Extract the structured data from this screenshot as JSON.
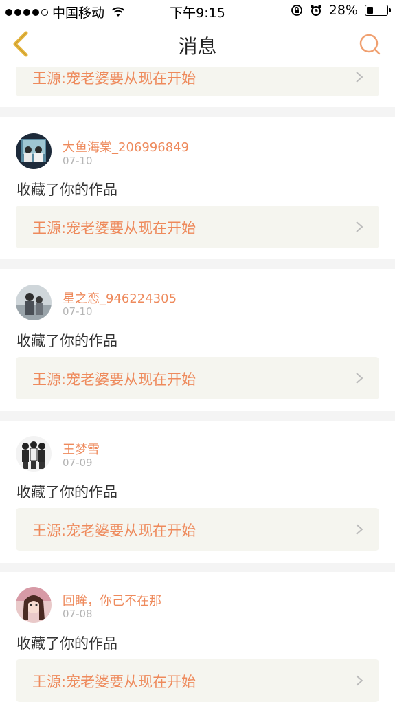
{
  "status_bar": {
    "carrier": "中国移动",
    "time": "下午9:15",
    "battery": "28%",
    "battery_level": 0.28
  },
  "nav": {
    "title": "消息",
    "back_icon": "chevron-left-icon",
    "search_icon": "search-icon"
  },
  "top_card": {
    "work_title": "王源:宠老婆要从现在开始"
  },
  "notifications": [
    {
      "user": "大鱼海棠_206996849",
      "date": "07-10",
      "action": "收藏了你的作品",
      "work_title": "王源:宠老婆要从现在开始"
    },
    {
      "user": "星之恋_946224305",
      "date": "07-10",
      "action": "收藏了你的作品",
      "work_title": "王源:宠老婆要从现在开始"
    },
    {
      "user": "王梦雪",
      "date": "07-09",
      "action": "收藏了你的作品",
      "work_title": "王源:宠老婆要从现在开始"
    },
    {
      "user": "回眸，你己不在那",
      "date": "07-08",
      "action": "收藏了你的作品",
      "work_title": "王源:宠老婆要从现在开始"
    }
  ],
  "colors": {
    "accent": "#ee8a5c",
    "back_icon": "#e6b53c",
    "search_icon": "#f0a070",
    "card_bg": "#f5f5ef"
  }
}
